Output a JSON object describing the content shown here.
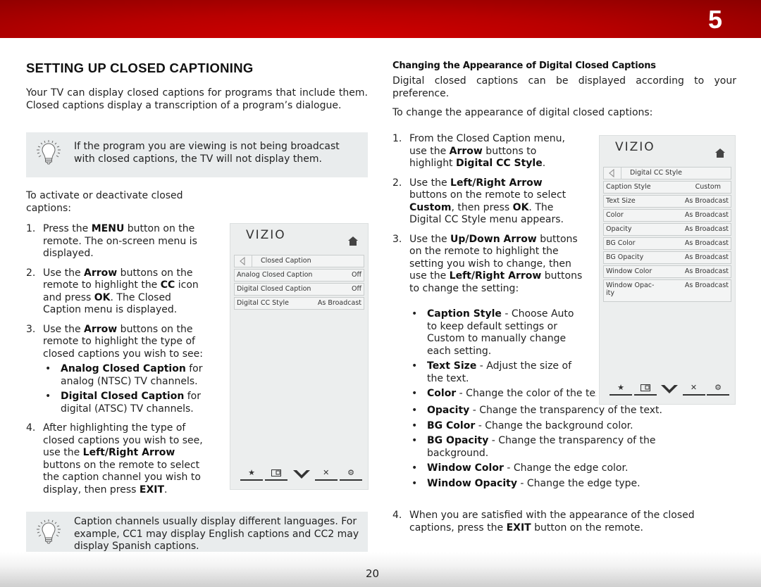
{
  "header": {
    "chapter_number": "5",
    "accent_color": "#c00000"
  },
  "left": {
    "title": "SETTING UP CLOSED CAPTIONING",
    "intro": "Your TV can display closed captions for programs that include them. Closed captions display a transcription of a program’s dialogue.",
    "tip1": "If the program you are viewing is not being broadcast with closed captions, the TV will not display them.",
    "activate_intro": "To activate or deactivate closed captions:",
    "steps": [
      {
        "num": "1.",
        "parts": [
          "Press the ",
          "MENU",
          " button on the remote. The on-screen menu is displayed."
        ]
      },
      {
        "num": "2.",
        "parts": [
          "Use the ",
          "Arrow",
          " buttons on the remote to highlight the ",
          "CC",
          " icon and press ",
          "OK",
          ". The Closed Caption menu is displayed."
        ]
      },
      {
        "num": "3.",
        "parts": [
          "Use the ",
          "Arrow",
          " buttons on the remote to highlight the type of closed captions you wish to see:"
        ]
      },
      {
        "num": "4.",
        "parts": [
          "After highlighting the type of closed captions you wish to see, use the ",
          "Left/Right Arrow",
          " buttons on the remote to select the caption channel you wish to display, then press ",
          "EXIT",
          "."
        ]
      }
    ],
    "step3_bullets": [
      {
        "term": "Analog Closed Caption",
        "desc": " for analog (NTSC) TV channels."
      },
      {
        "term": "Digital Closed Caption",
        "desc": " for digital (ATSC) TV channels."
      }
    ],
    "tip2": "Caption channels usually display different languages. For example, CC1 may display English captions and CC2 may display Spanish captions."
  },
  "menu1": {
    "logo": "VIZIO",
    "title": "Closed Caption",
    "rows": [
      {
        "label": "Analog Closed Caption",
        "value": "Off"
      },
      {
        "label": "Digital Closed Caption",
        "value": "Off"
      },
      {
        "label": "Digital CC Style",
        "value": "As Broadcast"
      }
    ],
    "icons": [
      "star-icon",
      "picture-in-picture-icon",
      "vizio-v-icon",
      "close-icon",
      "gear-icon"
    ]
  },
  "right": {
    "subtitle": "Changing the Appearance of Digital Closed Captions",
    "intro": "Digital closed captions can be displayed according to your preference.",
    "change_intro": "To change the appearance of digital closed captions:",
    "steps": [
      {
        "num": "1.",
        "parts": [
          "From the Closed Caption menu, use the ",
          "Arrow",
          " buttons to highlight ",
          "Digital CC Style",
          "."
        ]
      },
      {
        "num": "2.",
        "parts": [
          "Use the ",
          "Left/Right Arrow",
          " buttons on the remote to select ",
          "Custom",
          ", then press ",
          "OK",
          ". The Digital CC Style menu appears."
        ]
      },
      {
        "num": "3.",
        "parts": [
          "Use the ",
          "Up/Down Arrow",
          " buttons on the remote to highlight the setting you wish to change, then use the ",
          "Left/Right Arrow",
          " buttons to change the setting:"
        ]
      },
      {
        "num": "4.",
        "parts": [
          "When you are satisfied with the appearance of the closed captions, press the ",
          "EXIT",
          " button on the remote."
        ]
      }
    ],
    "bullets": [
      {
        "term": "Caption Style",
        "desc": " - Choose Auto to keep default settings or Custom to manually change each setting."
      },
      {
        "term": "Text Size",
        "desc": " - Adjust the size of the text."
      },
      {
        "term": "Color",
        "desc": " - Change the color of the text."
      },
      {
        "term": "Opacity",
        "desc": " - Change the transparency of the text."
      },
      {
        "term": "BG Color",
        "desc": " - Change the background color."
      },
      {
        "term": "BG Opacity",
        "desc": " - Change the transparency of the background."
      },
      {
        "term": "Window Color",
        "desc": " - Change the edge color."
      },
      {
        "term": "Window Opacity",
        "desc": " - Change the edge type."
      }
    ]
  },
  "menu2": {
    "logo": "VIZIO",
    "title": "Digital CC Style",
    "rows": [
      {
        "label": "Caption Style",
        "value": "Custom"
      },
      {
        "label": "Text Size",
        "value": "As Broadcast"
      },
      {
        "label": "Color",
        "value": "As Broadcast"
      },
      {
        "label": "Opacity",
        "value": "As Broadcast"
      },
      {
        "label": "BG Color",
        "value": "As Broadcast"
      },
      {
        "label": "BG Opacity",
        "value": "As Broadcast"
      },
      {
        "label": "Window Color",
        "value": "As Broadcast"
      },
      {
        "label": "Window Opac-ity",
        "value": "As Broadcast"
      }
    ]
  },
  "footer": {
    "page_number": "20"
  }
}
